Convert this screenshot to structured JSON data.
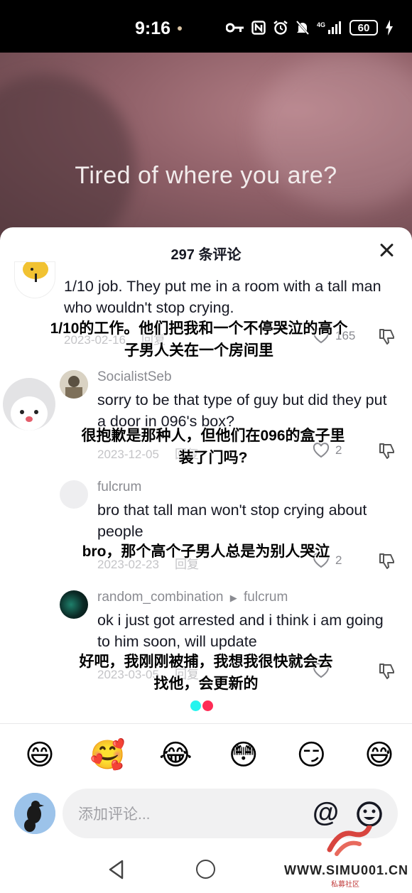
{
  "status_bar": {
    "time": "9:16",
    "battery": "60",
    "network": "4G"
  },
  "video": {
    "caption": "Tired of where you are?"
  },
  "comments_sheet": {
    "title": "297 条评论",
    "comments": [
      {
        "username": "",
        "text": "1/10 job. They put me in a room with a tall man who wouldn't stop crying.",
        "translation": "1/10的工作。他们把我和一个不停哭泣的高个子男人关在一个房间里",
        "date": "2023-02-16",
        "reply_label": "回复",
        "likes": "165"
      },
      {
        "username": "SocialistSeb",
        "text": "sorry to be that type of guy but did they put a door in 096's box?",
        "translation": "很抱歉是那种人，但他们在096的盒子里装了门吗?",
        "date": "2023-12-05",
        "reply_label": "回复",
        "likes": "2"
      },
      {
        "username": "fulcrum",
        "text": "bro that tall man won't stop crying about people",
        "translation": "bro，那个高个子男人总是为别人哭泣",
        "date": "2023-02-23",
        "reply_label": "回复",
        "likes": "2"
      },
      {
        "username": "random_combination",
        "reply_to": "fulcrum",
        "text": "ok i just got arrested and i think i am going to him soon, will update",
        "translation": "好吧，我刚刚被捕，我想我很快就会去找他，会更新的",
        "date": "2023-03-05",
        "reply_label": "回复",
        "likes": ""
      }
    ]
  },
  "emoji_bar": [
    "😄",
    "🥰",
    "😂",
    "😳",
    "😏",
    "😅"
  ],
  "comment_input": {
    "placeholder": "添加评论...",
    "at_symbol": "@"
  },
  "watermark": {
    "text": "WWW.SIMU001.CN",
    "subtext": "私募社区"
  },
  "colors": {
    "loading_dot_1": "#25f4ee",
    "loading_dot_2": "#fe2c55",
    "text_primary": "#161823",
    "text_secondary": "#8a8b91"
  }
}
